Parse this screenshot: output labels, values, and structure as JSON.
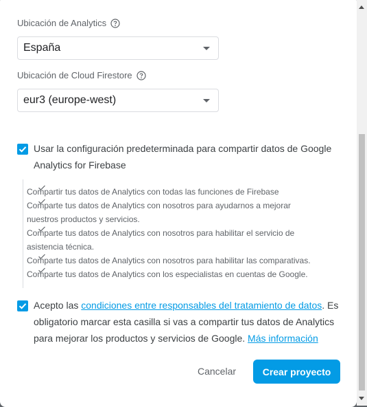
{
  "analytics": {
    "label": "Ubicación de Analytics",
    "value": "España"
  },
  "firestore": {
    "label": "Ubicación de Cloud Firestore",
    "value": "eur3 (europe-west)"
  },
  "default_config": {
    "checked": true,
    "label": "Usar la configuración predeterminada para compartir datos de Google Analytics for Firebase"
  },
  "sharing_items": [
    "Compartir tus datos de Analytics con todas las funciones de Firebase",
    "Comparte tus datos de Analytics con nosotros para ayudarnos a mejorar nuestros productos y servicios.",
    "Comparte tus datos de Analytics con nosotros para habilitar el servicio de asistencia técnica.",
    "Comparte tus datos de Analytics con nosotros para habilitar las comparativas.",
    "Comparte tus datos de Analytics con los especialistas en cuentas de Google."
  ],
  "terms": {
    "checked": true,
    "prefix": "Acepto las ",
    "link": "condiciones entre responsables del tratamiento de datos",
    "suffix": ". Es obligatorio marcar esta casilla si vas a compartir tus datos de Analytics para mejorar los productos y servicios de Google. ",
    "more_link": "Más información"
  },
  "actions": {
    "cancel": "Cancelar",
    "create": "Crear proyecto"
  },
  "colors": {
    "accent": "#039be5"
  }
}
